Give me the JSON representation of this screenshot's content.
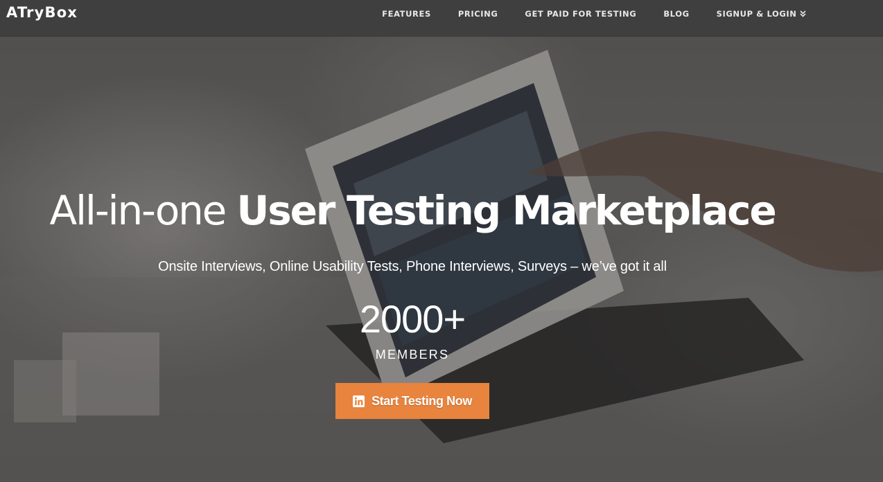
{
  "brand": {
    "logo_text": "ATryBox"
  },
  "nav": {
    "items": [
      {
        "label": "FEATURES"
      },
      {
        "label": "PRICING"
      },
      {
        "label": "GET PAID FOR TESTING"
      },
      {
        "label": "BLOG"
      },
      {
        "label": "SIGNUP & LOGIN",
        "icon": "double-chevron-down-icon"
      }
    ]
  },
  "hero": {
    "headline_light": "All-in-one ",
    "headline_bold": "User Testing Marketplace",
    "subheadline": "Onsite Interviews, Online Usability Tests, Phone Interviews, Surveys – we’ve got it all",
    "stat_number": "2000+",
    "stat_label": "MEMBERS",
    "cta_label": "Start Testing Now",
    "cta_icon": "linkedin-icon"
  },
  "colors": {
    "navbar_bg": "#3f3f3f",
    "cta_bg": "#e8843d",
    "text": "#ffffff"
  }
}
